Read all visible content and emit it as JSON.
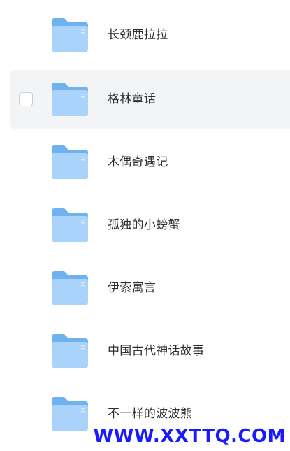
{
  "folders": [
    {
      "name": "长颈鹿拉拉"
    },
    {
      "name": "格林童话"
    },
    {
      "name": "木偶奇遇记"
    },
    {
      "name": "孤独的小螃蟹"
    },
    {
      "name": "伊索寓言"
    },
    {
      "name": "中国古代神话故事"
    },
    {
      "name": "不一样的波波熊"
    }
  ],
  "hovered_index": 1,
  "watermark": "WWW.XXTTQ.COM",
  "colors": {
    "folder_front": "#a9d3fb",
    "folder_back": "#6eb2f0",
    "hover_bg": "#f3f4f6",
    "watermark": "#1a1aff"
  }
}
